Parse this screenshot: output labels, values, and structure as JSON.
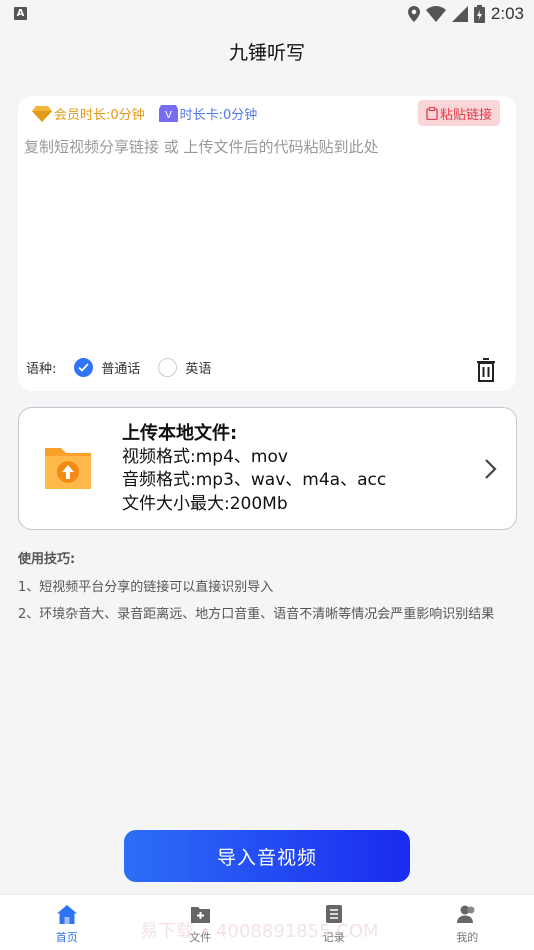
{
  "status_bar": {
    "time": "2:03",
    "notification_glyph": "A"
  },
  "header": {
    "title": "九锤听写"
  },
  "input_card": {
    "vip_duration": "会员时长:0分钟",
    "card_duration": "时长卡:0分钟",
    "paste_label": "粘贴链接",
    "placeholder": "复制短视频分享链接 或 上传文件后的代码粘贴到此处",
    "language_label": "语种:",
    "languages": [
      {
        "label": "普通话",
        "selected": true
      },
      {
        "label": "英语",
        "selected": false
      }
    ]
  },
  "upload_card": {
    "title": "上传本地文件:",
    "video_formats": "视频格式:mp4、mov",
    "audio_formats": "音频格式:mp3、wav、m4a、acc",
    "max_size": "文件大小最大:200Mb"
  },
  "tips": {
    "title": "使用技巧:",
    "items": [
      "1、短视频平台分享的链接可以直接识别导入",
      "2、环境杂音大、录音距离远、地方口音重、语音不清晰等情况会严重影响识别结果"
    ]
  },
  "import_button": "导入音视频",
  "tabs": [
    {
      "label": "首页",
      "icon": "home-icon",
      "active": true
    },
    {
      "label": "文件",
      "icon": "file-icon",
      "active": false
    },
    {
      "label": "记录",
      "icon": "record-icon",
      "active": false
    },
    {
      "label": "我的",
      "icon": "profile-icon",
      "active": false
    }
  ],
  "watermark": "易下载 • 4008891855.COM",
  "colors": {
    "accent": "#2f74f5",
    "paste_bg": "#fad6d9",
    "paste_text": "#e03c4a",
    "vip": "#e39a14"
  }
}
